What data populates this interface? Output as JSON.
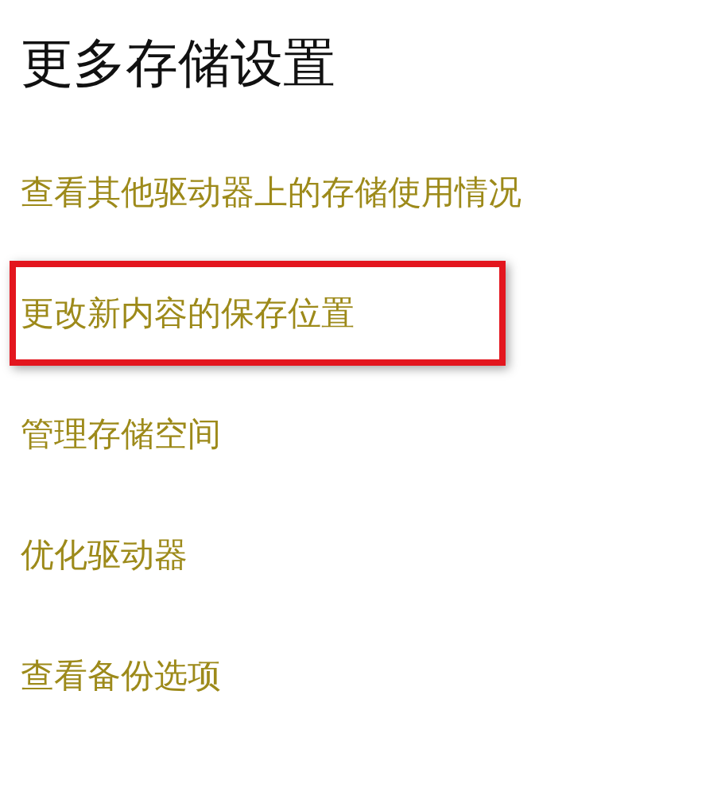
{
  "title": "更多存储设置",
  "links": [
    {
      "label": "查看其他驱动器上的存储使用情况",
      "highlighted": false
    },
    {
      "label": "更改新内容的保存位置",
      "highlighted": true
    },
    {
      "label": "管理存储空间",
      "highlighted": false
    },
    {
      "label": "优化驱动器",
      "highlighted": false
    },
    {
      "label": "查看备份选项",
      "highlighted": false
    }
  ]
}
